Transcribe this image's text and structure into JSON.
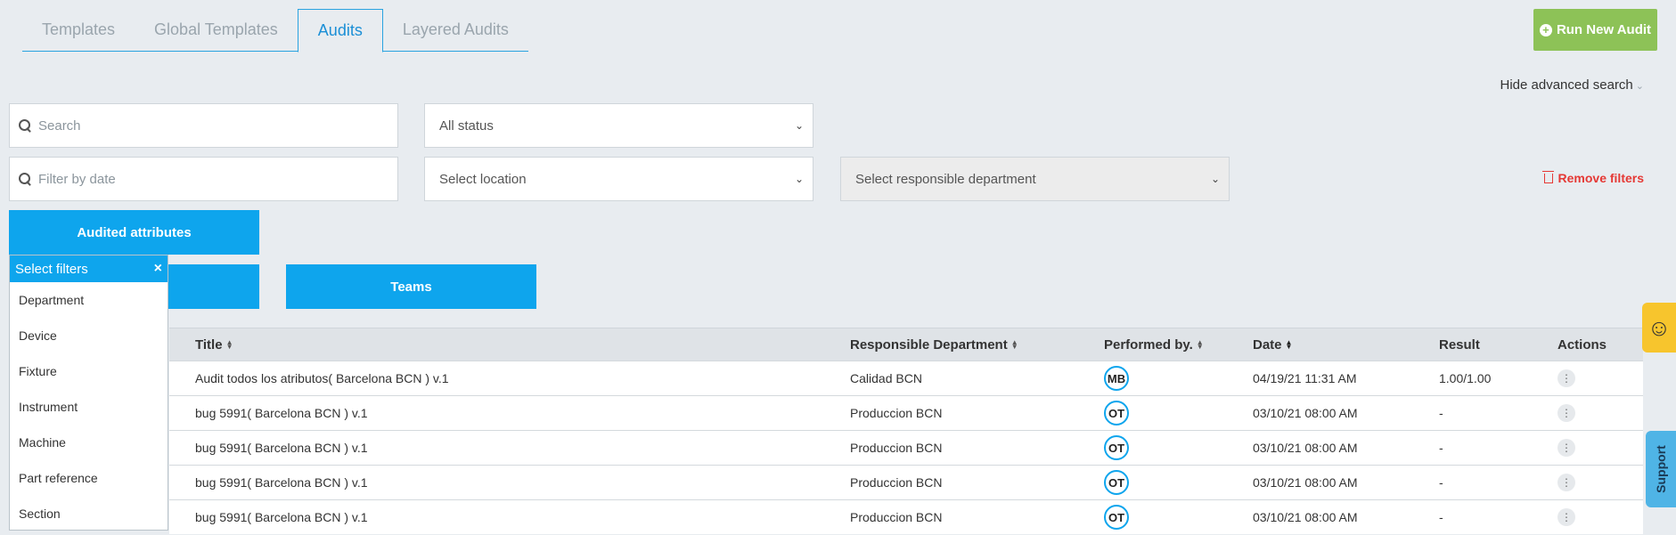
{
  "tabs": [
    {
      "label": "Templates"
    },
    {
      "label": "Global Templates"
    },
    {
      "label": "Audits"
    },
    {
      "label": "Layered Audits"
    }
  ],
  "run_button": {
    "label": "Run New Audit",
    "icon": "plus-circle-icon",
    "color": "#8dc257"
  },
  "advanced_search": {
    "label": "Hide advanced search"
  },
  "filters": {
    "search_placeholder": "Search",
    "status_value": "All status",
    "date_placeholder": "Filter by date",
    "location_value": "Select location",
    "department_value": "Select responsible department",
    "remove_label": "Remove filters"
  },
  "buttons": {
    "audited_attributes": "Audited attributes",
    "teams": "Teams"
  },
  "dropdown": {
    "title": "Select filters",
    "close": "×",
    "items": [
      "Department",
      "Device",
      "Fixture",
      "Instrument",
      "Machine",
      "Part reference",
      "Section"
    ]
  },
  "table": {
    "headers": {
      "title": "Title",
      "department": "Responsible Department",
      "performed": "Performed by.",
      "date": "Date",
      "result": "Result",
      "actions": "Actions"
    },
    "rows": [
      {
        "title": "Audit todos los atributos( Barcelona BCN ) v.1",
        "department": "Calidad BCN",
        "performed": "MB",
        "date": "04/19/21 11:31 AM",
        "result": "1.00/1.00"
      },
      {
        "title": "bug 5991( Barcelona BCN ) v.1",
        "department": "Produccion BCN",
        "performed": "OT",
        "date": "03/10/21 08:00 AM",
        "result": "-"
      },
      {
        "title": "bug 5991( Barcelona BCN ) v.1",
        "department": "Produccion BCN",
        "performed": "OT",
        "date": "03/10/21 08:00 AM",
        "result": "-"
      },
      {
        "title": "bug 5991( Barcelona BCN ) v.1",
        "department": "Produccion BCN",
        "performed": "OT",
        "date": "03/10/21 08:00 AM",
        "result": "-"
      },
      {
        "title": "bug 5991( Barcelona BCN ) v.1",
        "department": "Produccion BCN",
        "performed": "OT",
        "date": "03/10/21 08:00 AM",
        "result": "-"
      }
    ]
  },
  "side": {
    "feedback_icon": "smiley-icon",
    "support_label": "Support"
  },
  "colors": {
    "accent": "#0ea5ed",
    "danger": "#e53935",
    "tab_active": "#1b8fd6"
  }
}
